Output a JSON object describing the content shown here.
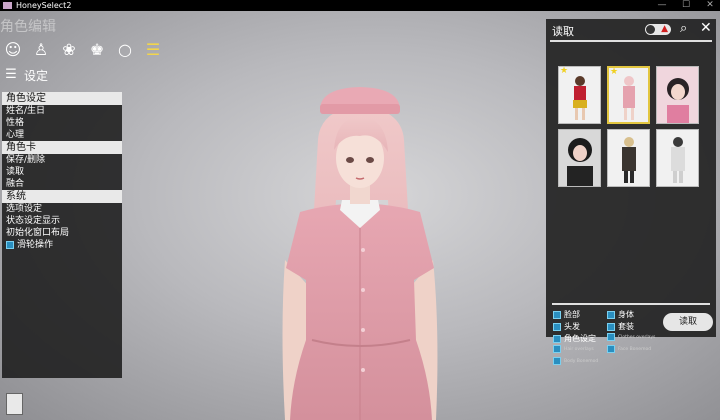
{
  "window": {
    "title": "HoneySelect2",
    "controls": [
      "—",
      "☐",
      "✕"
    ]
  },
  "top": {
    "faded_title": "角色编辑",
    "icons": [
      "face-icon",
      "body-icon",
      "hair-icon",
      "clothes-icon",
      "accessory-icon",
      "list-icon"
    ],
    "settings_label": "设定"
  },
  "menu": {
    "sections": [
      {
        "title": "角色设定",
        "items": [
          "姓名/生日",
          "性格",
          "心理"
        ]
      },
      {
        "title": "角色卡",
        "items": [
          "保存/删除",
          "读取",
          "融合"
        ]
      },
      {
        "title": "系统",
        "items": [
          "选项设定",
          "状态设定显示",
          "初始化窗口布局"
        ]
      }
    ],
    "checkbox_item": "滑轮操作"
  },
  "panel": {
    "title": "读取",
    "cards_count": 6,
    "selected_index": 1,
    "starred": [
      0,
      1
    ],
    "options_left": [
      "脸部",
      "头发",
      "角色设定",
      "Hair overlays",
      "Body Bonemod"
    ],
    "options_right": [
      "身体",
      "套装",
      "Clothes overlays",
      "Face Bonemod"
    ],
    "load_button": "读取"
  },
  "colors": {
    "accent": "#f2d54b",
    "checkbox": "#2a8fc0",
    "panel": "#232323"
  }
}
